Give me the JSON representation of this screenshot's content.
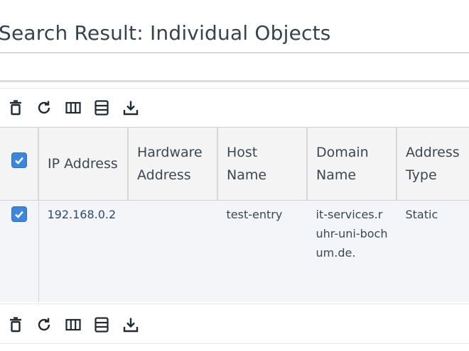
{
  "page": {
    "title": "Search Result: Individual Objects"
  },
  "toolbar_icons": [
    "delete-icon",
    "refresh-icon",
    "columns-icon",
    "rows-icon",
    "download-icon"
  ],
  "table": {
    "select_all_checked": true,
    "columns": [
      {
        "key": "ip",
        "label": "IP Address"
      },
      {
        "key": "hw",
        "label": "Hardware Address"
      },
      {
        "key": "host",
        "label": "Host Name"
      },
      {
        "key": "domain",
        "label": "Domain Name"
      },
      {
        "key": "type",
        "label": "Address Type"
      }
    ],
    "rows": [
      {
        "checked": true,
        "ip": "192.168.0.2",
        "hw": "",
        "host": "test-entry",
        "domain": "it-services.ruhr-uni-bochum.de.",
        "type": "Static"
      }
    ]
  },
  "colors": {
    "checkbox": "#3d86dd",
    "header_bg": "#f4f4f4",
    "row_bg": "#f3f5f8"
  }
}
